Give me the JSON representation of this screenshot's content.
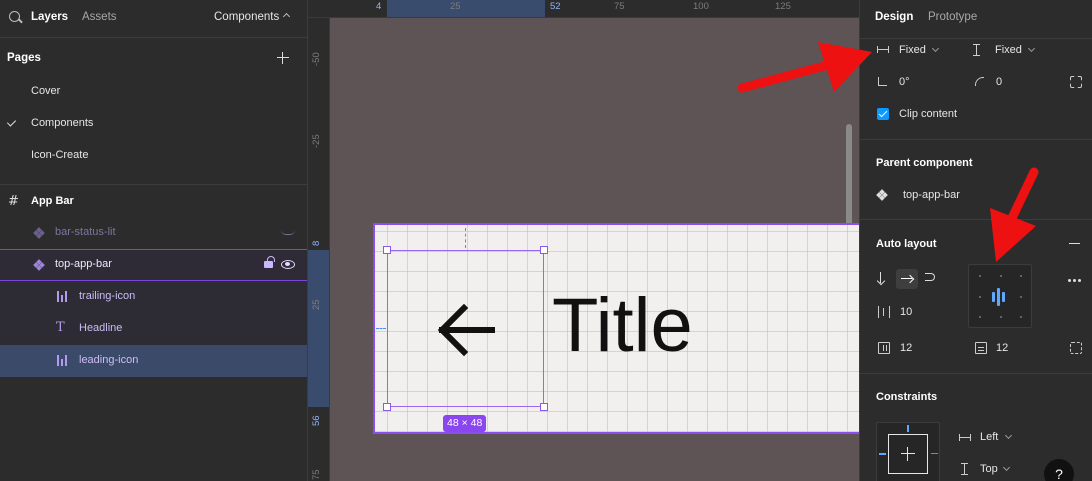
{
  "left_panel": {
    "tabs": {
      "layers": "Layers",
      "assets": "Assets"
    },
    "page_switcher": "Components",
    "pages_heading": "Pages",
    "pages": [
      "Cover",
      "Components",
      "Icon-Create"
    ],
    "current_page": "Components",
    "frame_name": "App Bar",
    "layers": {
      "bar_status": "bar-status-lit",
      "top_app_bar": "top-app-bar",
      "trailing_icon": "trailing-icon",
      "headline": "Headline",
      "leading_icon": "leading-icon"
    }
  },
  "rulers": {
    "top": [
      "4",
      "25",
      "52",
      "75",
      "100",
      "125"
    ],
    "left": [
      "-50",
      "-25",
      "8",
      "25",
      "56",
      "75"
    ]
  },
  "canvas": {
    "title_text": "Title",
    "size_badge": "48 × 48",
    "colors": {
      "selection": "#8a4ef0",
      "canvas_bg": "#5e5355",
      "frame_bg": "#f2efef"
    }
  },
  "right_panel": {
    "tabs": {
      "design": "Design",
      "prototype": "Prototype"
    },
    "width_mode": "Fixed",
    "height_mode": "Fixed",
    "rotation": "0°",
    "corner_radius": "0",
    "clip_content_label": "Clip content",
    "clip_content_checked": true,
    "parent_component_heading": "Parent component",
    "parent_component_name": "top-app-bar",
    "auto_layout_heading": "Auto layout",
    "gap": "10",
    "padding_horizontal": "12",
    "padding_vertical": "12",
    "constraints_heading": "Constraints",
    "constraint_horizontal": "Left",
    "constraint_vertical": "Top",
    "help": "?"
  }
}
